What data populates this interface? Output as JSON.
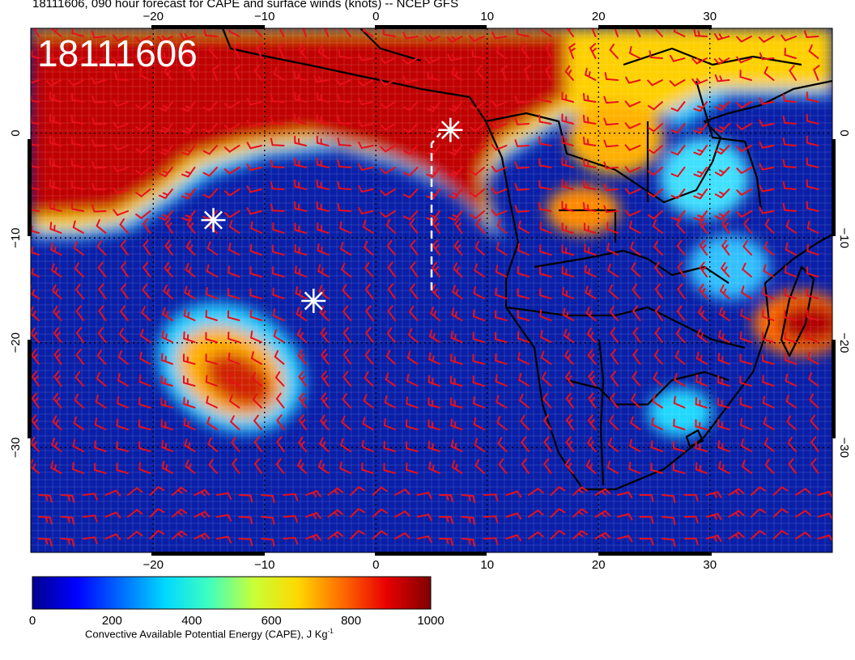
{
  "title": "18111606, 090 hour forecast for CAPE and surface winds (knots) -- NCEP GFS",
  "stamp": "18111606",
  "map": {
    "lon_range": [
      -31,
      41
    ],
    "lat_range": [
      -40,
      10
    ],
    "lon_ticks": [
      -20,
      -10,
      0,
      10,
      20,
      30
    ],
    "lat_ticks": [
      0,
      -10,
      -20,
      -30
    ],
    "lon_tick_labels": [
      "−20",
      "−10",
      "0",
      "10",
      "20",
      "30"
    ],
    "lat_tick_labels": [
      "0",
      "−10",
      "−20",
      "−30"
    ],
    "wind_barb_color": "#e8101a",
    "coastline_color": "#000000",
    "marker_color": "#ffffff"
  },
  "markers": [
    {
      "name": "asterisk",
      "lon": -14.6,
      "lat": -8.3
    },
    {
      "name": "asterisk",
      "lon": -5.6,
      "lat": -16.0
    },
    {
      "name": "asterisk",
      "lon": 6.7,
      "lat": 0.3
    }
  ],
  "track": {
    "points": [
      [
        5.0,
        -15.0
      ],
      [
        5.0,
        -1.0
      ],
      [
        5.8,
        0.0
      ]
    ]
  },
  "colorbar": {
    "label": "Convective Available Potential Energy (CAPE), J Kg",
    "label_sup": "-1",
    "ticks": [
      "0",
      "200",
      "400",
      "600",
      "800",
      "1000"
    ],
    "min": 0,
    "max": 1000,
    "colors": [
      "#00008f",
      "#0000ff",
      "#006bff",
      "#00d8ff",
      "#40ffbf",
      "#c8ff38",
      "#ffd800",
      "#ff6b00",
      "#e80000",
      "#7f0000"
    ]
  }
}
